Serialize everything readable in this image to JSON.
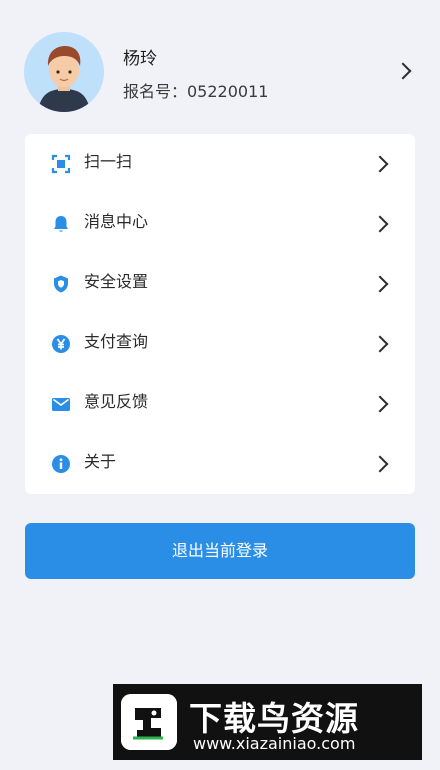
{
  "profile": {
    "name": "杨玲",
    "reg_no": "报名号：05220011",
    "avatar_icon": "user-avatar-icon",
    "chevron_icon": "chevron-right-icon"
  },
  "menu": {
    "items": [
      {
        "label": "扫一扫",
        "icon": "scan-icon"
      },
      {
        "label": "消息中心",
        "icon": "bell-icon"
      },
      {
        "label": "安全设置",
        "icon": "shield-icon"
      },
      {
        "label": "支付查询",
        "icon": "yen-icon"
      },
      {
        "label": "意见反馈",
        "icon": "mail-icon"
      },
      {
        "label": "关于",
        "icon": "info-icon"
      }
    ]
  },
  "logout": {
    "label": "退出当前登录"
  },
  "watermark": {
    "title": "下载鸟资源",
    "url": "www.xiazainiao.com",
    "logo_icon": "bird-logo-icon"
  },
  "colors": {
    "accent": "#2b8ee6",
    "background": "#f1f2f7",
    "card": "#ffffff"
  }
}
